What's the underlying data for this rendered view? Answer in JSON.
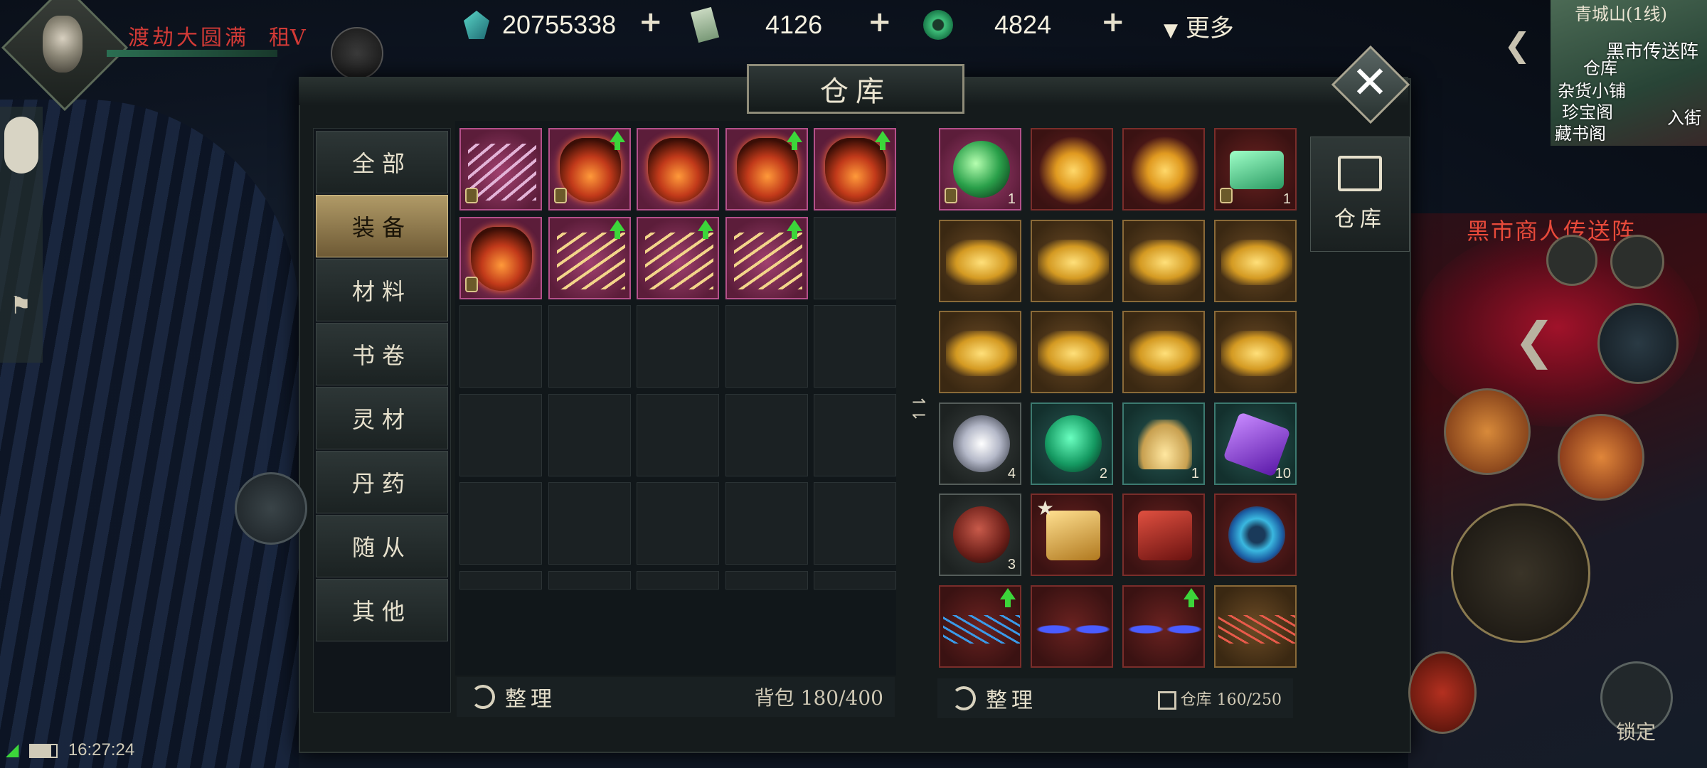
{
  "player": {
    "title": "渡劫大圆满",
    "flag": "租V"
  },
  "currencies": [
    {
      "icon": "spirit-stone-icon",
      "value": "20755338"
    },
    {
      "icon": "talisman-icon",
      "value": "4126"
    },
    {
      "icon": "jade-coin-icon",
      "value": "4824"
    }
  ],
  "more_label": "更多",
  "minimap": {
    "location": "青城山(1线)",
    "labels": [
      "黑市传送阵",
      "仓库",
      "杂货小铺",
      "珍宝阁",
      "藏书阁",
      "入街"
    ]
  },
  "npc_label": "黑市商人传送阵",
  "window": {
    "title": "仓库"
  },
  "tabs": [
    "全部",
    "装备",
    "材料",
    "书卷",
    "灵材",
    "丹药",
    "随从",
    "其他"
  ],
  "active_tab": "装备",
  "bag": {
    "sort_label": "整理",
    "capacity_label": "背包 180/400",
    "items": [
      {
        "name": "jeweled-fans",
        "style": "pink",
        "upgrade": false,
        "locked": true
      },
      {
        "name": "flame-lantern",
        "style": "pink",
        "upgrade": true,
        "locked": true
      },
      {
        "name": "flame-lantern",
        "style": "pink",
        "upgrade": false,
        "locked": false
      },
      {
        "name": "flame-lantern",
        "style": "pink",
        "upgrade": true,
        "locked": false
      },
      {
        "name": "flame-lantern",
        "style": "pink",
        "upgrade": true,
        "locked": false
      },
      {
        "name": "flame-lantern",
        "style": "pink",
        "upgrade": false,
        "locked": true
      },
      {
        "name": "golden-fans",
        "style": "pink",
        "upgrade": true,
        "locked": false
      },
      {
        "name": "golden-fans",
        "style": "pink",
        "upgrade": true,
        "locked": false
      },
      {
        "name": "golden-fans",
        "style": "pink",
        "upgrade": true,
        "locked": false
      }
    ]
  },
  "warehouse": {
    "tab_label": "仓库",
    "sort_label": "整理",
    "capacity_label": "仓库 160/250",
    "items": [
      {
        "name": "jade-orb",
        "style": "pink",
        "count": "1",
        "locked": true
      },
      {
        "name": "golden-wings",
        "style": "red"
      },
      {
        "name": "golden-wings",
        "style": "red"
      },
      {
        "name": "jade-slip",
        "style": "red",
        "count": "1",
        "locked": true
      },
      {
        "name": "golden-crown",
        "style": "gold"
      },
      {
        "name": "golden-crown",
        "style": "gold"
      },
      {
        "name": "golden-crown",
        "style": "gold"
      },
      {
        "name": "golden-crown",
        "style": "gold"
      },
      {
        "name": "golden-crown",
        "style": "gold"
      },
      {
        "name": "golden-crown",
        "style": "gold"
      },
      {
        "name": "golden-crown",
        "style": "gold"
      },
      {
        "name": "golden-crown",
        "style": "gold"
      },
      {
        "name": "silver-orb",
        "style": "gray",
        "count": "4"
      },
      {
        "name": "jade-pendant",
        "style": "teal",
        "count": "2"
      },
      {
        "name": "golden-sand",
        "style": "teal",
        "count": "1"
      },
      {
        "name": "purple-crystal",
        "style": "teal",
        "count": "10"
      },
      {
        "name": "red-jar",
        "style": "gray",
        "count": "3"
      },
      {
        "name": "golden-token",
        "style": "red",
        "star": true
      },
      {
        "name": "red-seal",
        "style": "red"
      },
      {
        "name": "azure-swirl",
        "style": "red"
      },
      {
        "name": "blue-wire",
        "style": "red",
        "upgrade": true
      },
      {
        "name": "blue-dragons",
        "style": "red"
      },
      {
        "name": "blue-dragons",
        "style": "red",
        "upgrade": true
      },
      {
        "name": "red-wire",
        "style": "gold"
      }
    ]
  },
  "controls": {
    "lock_label": "锁定"
  },
  "status": {
    "time": "16:27:24"
  }
}
